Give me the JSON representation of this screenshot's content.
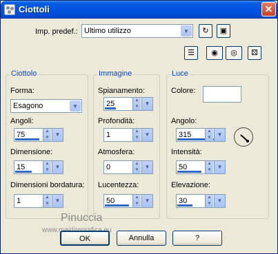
{
  "window": {
    "title": "Ciottoli",
    "close_glyph": "✕"
  },
  "preset": {
    "label": "Imp. predef.:",
    "value": "Ultimo utilizzo"
  },
  "toolbar_icons": [
    "reset-icon",
    "save-icon",
    "layout-icon",
    "eye-icon",
    "eye-open-icon",
    "dice-icon"
  ],
  "ciottolo": {
    "title": "Ciottolo",
    "forma_label": "Forma:",
    "forma_value": "Esagono",
    "angoli_label": "Angoli:",
    "angoli_value": "75",
    "dimensione_label": "Dimensione:",
    "dimensione_value": "15",
    "bordatura_label": "Dimensioni bordatura:",
    "bordatura_value": "1"
  },
  "immagine": {
    "title": "Immagine",
    "spianamento_label": "Spianamento:",
    "spianamento_value": "25",
    "profondita_label": "Profondità:",
    "profondita_value": "1",
    "atmosfera_label": "Atmosfera:",
    "atmosfera_value": "0",
    "lucentezza_label": "Lucentezza:",
    "lucentezza_value": "50"
  },
  "luce": {
    "title": "Luce",
    "colore_label": "Colore:",
    "colore_value": "#ffffff",
    "angolo_label": "Angolo:",
    "angolo_value": "315",
    "intensita_label": "Intensità:",
    "intensita_value": "50",
    "elevazione_label": "Elevazione:",
    "elevazione_value": "30"
  },
  "buttons": {
    "ok": "OK",
    "cancel": "Annulla",
    "help": "?"
  },
  "watermark": {
    "name": "Pinuccia",
    "url": "www.maidiregrafica.eu"
  },
  "colors": {
    "title_bar": "#0054e3",
    "group_title": "#0046d5",
    "spin_bar": "#316ac5",
    "window_bg": "#ece9d8"
  }
}
